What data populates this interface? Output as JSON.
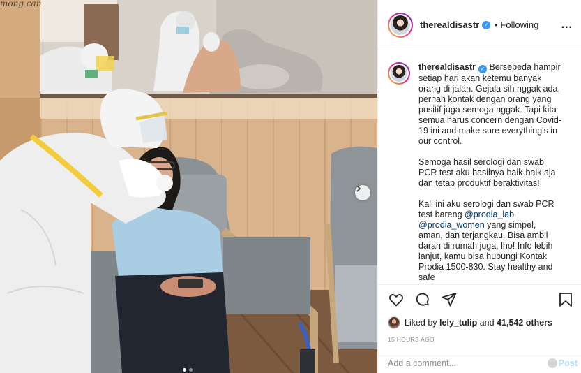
{
  "photo": {
    "top_caption": "mong can",
    "next_icon": "chevron-right-icon",
    "carousel_dots": 2,
    "active_dot": 0
  },
  "header": {
    "username": "therealdisastr",
    "verified_icon": "verified-badge-icon",
    "separator": "•",
    "follow_status": "Following",
    "more_label": "..."
  },
  "caption": {
    "username": "therealdisastr",
    "paragraphs": [
      "Bersepeda hampir setiap hari akan ketemu banyak orang di jalan. Gejala sih nggak ada, pernah kontak dengan orang yang positif juga semoga nggak. Tapi kita semua harus concern dengan Covid-19 ini and make sure everything's in our control.",
      "Semoga hasil serologi dan swab PCR test aku hasilnya baik-baik aja dan tetap produktif beraktivitas!"
    ],
    "p3_start": "Kali ini aku serologi dan swab PCR test bareng ",
    "mention1": "@prodia_lab",
    "mention2": "@prodia_women",
    "p3_end": " yang simpel, aman, dan terjangkau. Bisa ambil darah di rumah juga, lho! Info lebih lanjut, kamu bisa hubungi Kontak Prodia 1500-830. Stay healthy and safe"
  },
  "actions": {
    "like_icon": "heart-icon",
    "comment_icon": "comment-icon",
    "share_icon": "share-icon",
    "save_icon": "bookmark-icon"
  },
  "likes": {
    "prefix": "Liked by ",
    "user": "lely_tulip",
    "middle": " and ",
    "count": "41,542 others"
  },
  "timestamp": "15 HOURS AGO",
  "comment_box": {
    "placeholder": "Add a comment...",
    "post_label": "Post"
  },
  "colors": {
    "accent_blue": "#3897f0",
    "post_disabled": "#b2dffc",
    "mention": "#00376b",
    "muted": "#8e8e8e"
  }
}
